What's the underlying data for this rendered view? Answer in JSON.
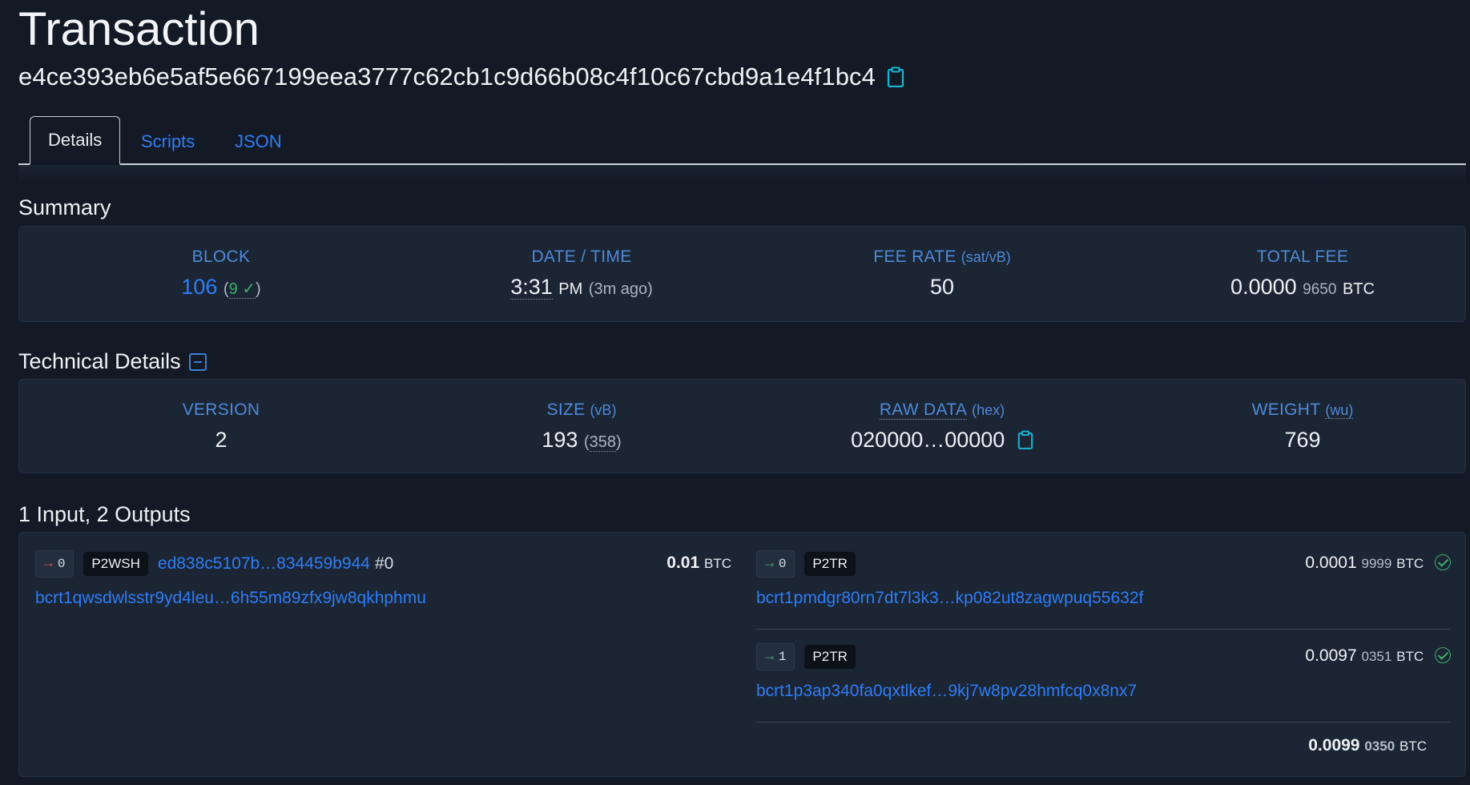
{
  "page": {
    "title": "Transaction",
    "txid": "e4ce393eb6e5af5e667199eea3777c62cb1c9d66b08c4f10c67cbd9a1e4f1bc4"
  },
  "tabs": [
    {
      "label": "Details",
      "active": true
    },
    {
      "label": "Scripts",
      "active": false
    },
    {
      "label": "JSON",
      "active": false
    }
  ],
  "summary": {
    "title": "Summary",
    "block": {
      "label": "BLOCK",
      "height": "106",
      "confirmations": "9",
      "open_paren": "(",
      "close_paren": ")"
    },
    "datetime": {
      "label": "DATE / TIME",
      "time": "3:31",
      "ampm": "PM",
      "ago": "(3m ago)"
    },
    "fee_rate": {
      "label": "FEE RATE",
      "unit": "(sat/vB)",
      "value": "50"
    },
    "total_fee": {
      "label": "TOTAL FEE",
      "main": "0.0000",
      "tail": "9650",
      "unit": "BTC"
    }
  },
  "technical": {
    "title": "Technical Details",
    "version": {
      "label": "VERSION",
      "value": "2"
    },
    "size": {
      "label": "SIZE",
      "unit": "(vB)",
      "value": "193",
      "open_paren": "(",
      "raw": "358",
      "close_paren": ")"
    },
    "raw_data": {
      "label": "RAW DATA",
      "unit": "(hex)",
      "value": "020000…00000"
    },
    "weight": {
      "label": "WEIGHT",
      "unit": "(wu)",
      "value": "769"
    }
  },
  "io": {
    "title": "1 Input, 2 Outputs",
    "inputs": [
      {
        "index": "0",
        "type": "P2WSH",
        "prev_txid": "ed838c5107b…834459b944",
        "prev_vout": "#0",
        "amount_main": "0.01",
        "amount_unit": "BTC",
        "address": "bcrt1qwsdwlsstr9yd4leu…6h55m89zfx9jw8qkhphmu"
      }
    ],
    "outputs": [
      {
        "index": "0",
        "type": "P2TR",
        "amount_main": "0.0001",
        "amount_tail": "9999",
        "amount_unit": "BTC",
        "address": "bcrt1pmdgr80rn7dt7l3k3…kp082ut8zagwpuq55632f"
      },
      {
        "index": "1",
        "type": "P2TR",
        "amount_main": "0.0097",
        "amount_tail": "0351",
        "amount_unit": "BTC",
        "address": "bcrt1p3ap340fa0qxtlkef…9kj7w8pv28hmfcq0x8nx7"
      }
    ],
    "total": {
      "main": "0.0099",
      "tail": "0350",
      "unit": "BTC"
    }
  },
  "icons": {
    "copy": "clipboard-icon",
    "collapse": "minus-square-icon",
    "confirmed": "check-circle-icon",
    "input_arrow": "arrow-right-icon",
    "output_arrow": "arrow-right-icon"
  },
  "colors": {
    "background": "#131a26",
    "card": "#1b2534",
    "link": "#2f7df6",
    "label": "#4e8ad8",
    "success": "#3fae6a",
    "spend": "#e04b4b"
  }
}
